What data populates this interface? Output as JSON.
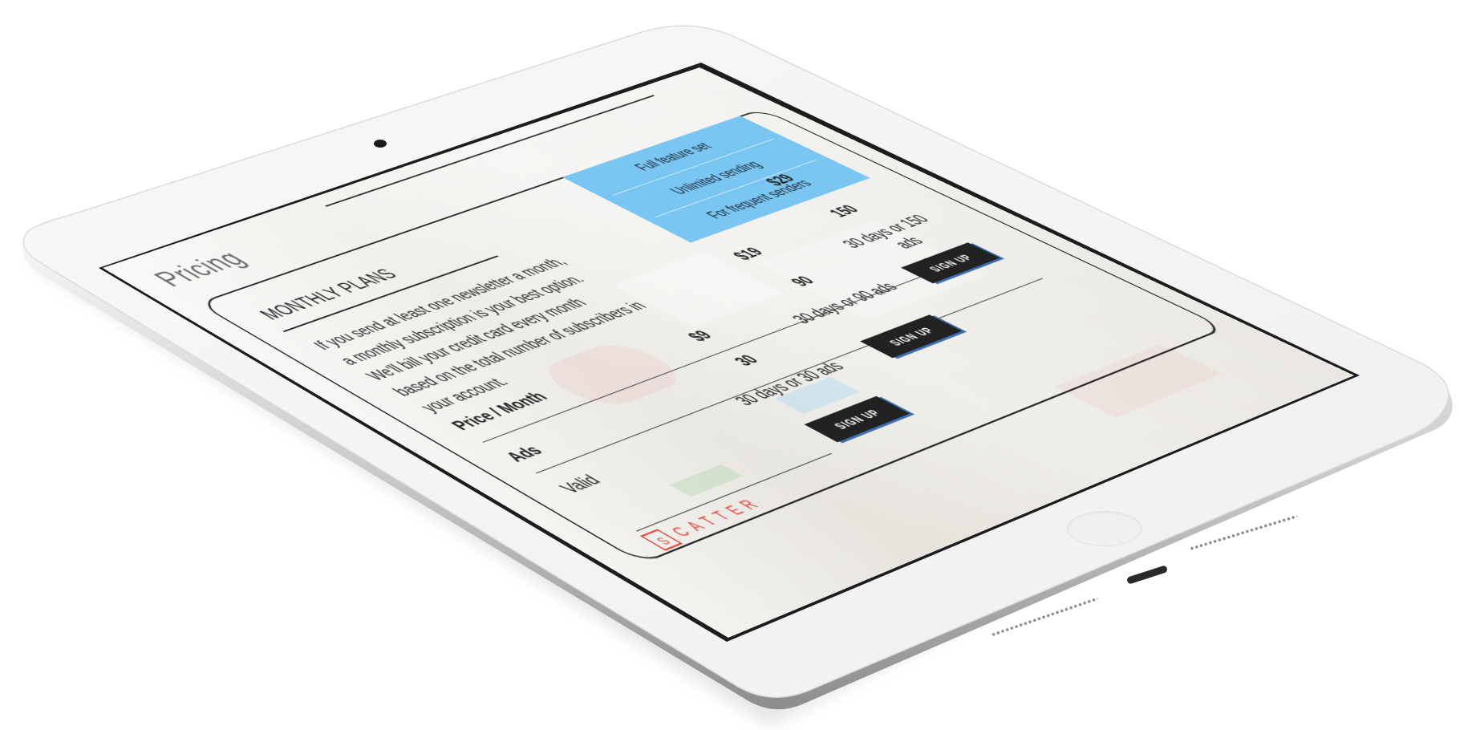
{
  "page": {
    "title": "Pricing"
  },
  "section": {
    "heading": "MONTHLY PLANS",
    "intro": "If you send at least one newsletter a month, a monthly subscription is your best option. We'll bill your credit card every month based on the total number of subscribers in your account."
  },
  "features": [
    "Full feature set",
    "Unlimited sending",
    "For frequent senders"
  ],
  "table": {
    "rows": [
      {
        "label": "Price / Month",
        "values": [
          "$9",
          "$19",
          "$29"
        ]
      },
      {
        "label": "Ads",
        "values": [
          "30",
          "90",
          "150"
        ]
      },
      {
        "label": "Valid",
        "values": [
          "30 days or 30 ads",
          "30 days or 90 ads",
          "30 days or 150 ads"
        ]
      }
    ],
    "signup_label": "SIGN UP"
  },
  "logo": {
    "mark": "S",
    "text": "CATTER",
    "color": "#e8463d"
  },
  "colors": {
    "feature_highlight": "#79c6f2",
    "button_bg": "#222222",
    "button_shadow": "#3d6fb5"
  }
}
